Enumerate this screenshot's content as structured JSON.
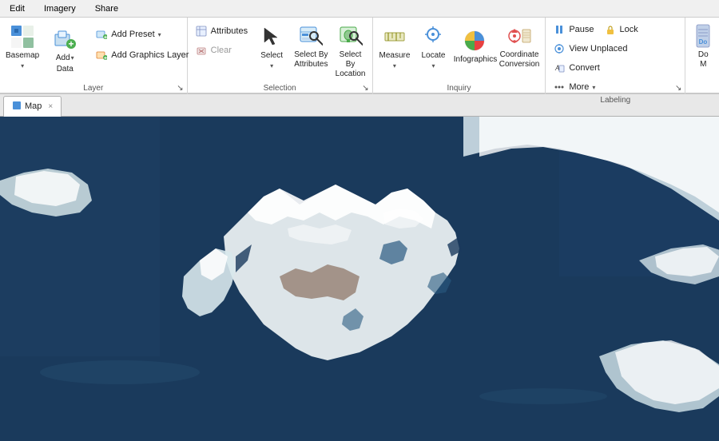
{
  "menu": {
    "items": [
      "Edit",
      "Imagery",
      "Share"
    ]
  },
  "ribbon": {
    "groups": [
      {
        "name": "layer",
        "label": "Layer",
        "buttons": [
          {
            "id": "basemap",
            "label": "Basemap",
            "icon": "basemap-icon"
          },
          {
            "id": "add-data",
            "label": "Add\nData",
            "icon": "add-data-icon"
          }
        ],
        "small_buttons": [
          {
            "id": "add-preset",
            "label": "Add Preset",
            "icon": "add-preset-icon"
          },
          {
            "id": "add-graphics-layer",
            "label": "Add Graphics Layer",
            "icon": "add-graphics-icon"
          }
        ]
      },
      {
        "name": "selection",
        "label": "Selection",
        "buttons": [
          {
            "id": "select",
            "label": "Select",
            "icon": "select-icon"
          },
          {
            "id": "select-by-attributes",
            "label": "Select By\nAttributes",
            "icon": "select-attr-icon"
          },
          {
            "id": "select-by-location",
            "label": "Select By\nLocation",
            "icon": "select-loc-icon"
          }
        ],
        "small_buttons": [
          {
            "id": "attributes",
            "label": "Attributes",
            "icon": "attributes-icon"
          },
          {
            "id": "clear",
            "label": "Clear",
            "icon": "clear-icon"
          }
        ]
      },
      {
        "name": "inquiry",
        "label": "Inquiry",
        "buttons": [
          {
            "id": "measure",
            "label": "Measure",
            "icon": "measure-icon"
          },
          {
            "id": "locate",
            "label": "Locate",
            "icon": "locate-icon"
          },
          {
            "id": "infographics",
            "label": "Infographics",
            "icon": "infographics-icon"
          },
          {
            "id": "coordinate-conversion",
            "label": "Coordinate\nConversion",
            "icon": "coord-conv-icon"
          }
        ]
      },
      {
        "name": "labeling",
        "label": "Labeling",
        "buttons": [
          {
            "id": "pause",
            "label": "Pause",
            "icon": "pause-icon"
          },
          {
            "id": "lock",
            "label": "Lock",
            "icon": "lock-icon"
          },
          {
            "id": "view-unplaced",
            "label": "View Unplaced",
            "icon": "view-unplaced-icon"
          },
          {
            "id": "convert",
            "label": "Convert",
            "icon": "convert-icon"
          },
          {
            "id": "more",
            "label": "More",
            "icon": "more-icon"
          }
        ]
      },
      {
        "name": "extra",
        "label": "",
        "buttons": [
          {
            "id": "do-more",
            "label": "Do\nMore",
            "icon": "do-more-icon"
          }
        ]
      }
    ]
  },
  "tab": {
    "label": "Map",
    "close": "×"
  },
  "map": {
    "alt": "Aerial satellite map showing mountainous terrain with snow-covered peaks and dark blue water"
  }
}
